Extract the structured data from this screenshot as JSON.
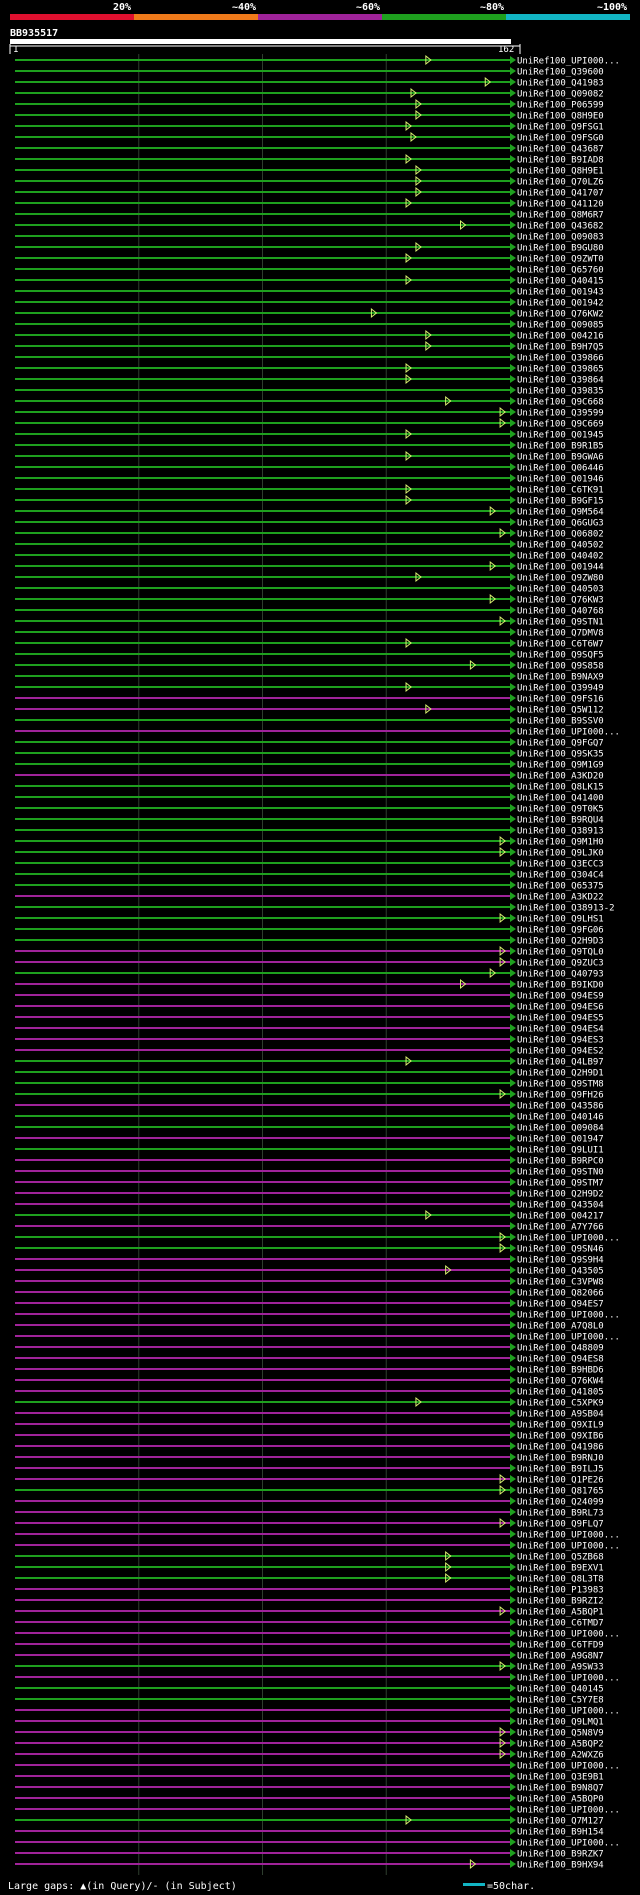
{
  "header": {
    "identity_scale": [
      {
        "label": "20%",
        "color": "#e0102f"
      },
      {
        "label": "~40%",
        "color": "#f07a1a"
      },
      {
        "label": "~60%",
        "color": "#a0239a"
      },
      {
        "label": "~80%",
        "color": "#1ea01e"
      },
      {
        "label": "~100%",
        "color": "#12b5c4"
      }
    ],
    "query_id": "BB935517",
    "ruler_start": "1",
    "ruler_end": "162"
  },
  "footer": {
    "legend_gaps": "Large gaps: ▲(in Query)/- (in Subject)",
    "legend_scale": "=50char."
  },
  "colors": {
    "green": "#1ea01e",
    "magenta": "#a0239a",
    "marker": "#d8f070",
    "background": "#000000"
  },
  "chart_data": {
    "type": "alignment",
    "query_length": 162,
    "row_count": 164,
    "rows": [
      {
        "id": "UniRef100_UPI000...",
        "color": "green",
        "end_marker": 0.83
      },
      {
        "id": "UniRef100_Q39600",
        "color": "green"
      },
      {
        "id": "UniRef100_Q41983",
        "color": "green",
        "end_marker": 0.95
      },
      {
        "id": "UniRef100_Q09082",
        "color": "green",
        "end_marker": 0.8
      },
      {
        "id": "UniRef100_P06599",
        "color": "green",
        "end_marker": 0.81
      },
      {
        "id": "UniRef100_Q8H9E0",
        "color": "green",
        "end_marker": 0.81
      },
      {
        "id": "UniRef100_Q9FSG1",
        "color": "green",
        "end_marker": 0.79
      },
      {
        "id": "UniRef100_Q9FSG0",
        "color": "green",
        "end_marker": 0.8
      },
      {
        "id": "UniRef100_Q43687",
        "color": "green"
      },
      {
        "id": "UniRef100_B9IAD8",
        "color": "green",
        "end_marker": 0.79
      },
      {
        "id": "UniRef100_Q8H9E1",
        "color": "green",
        "end_marker": 0.81
      },
      {
        "id": "UniRef100_Q70LZ6",
        "color": "green",
        "end_marker": 0.81
      },
      {
        "id": "UniRef100_Q41707",
        "color": "green",
        "end_marker": 0.81
      },
      {
        "id": "UniRef100_Q41120",
        "color": "green",
        "end_marker": 0.79
      },
      {
        "id": "UniRef100_Q8M6R7",
        "color": "green"
      },
      {
        "id": "UniRef100_Q43682",
        "color": "green",
        "end_marker": 0.9
      },
      {
        "id": "UniRef100_Q09083",
        "color": "green"
      },
      {
        "id": "UniRef100_B9GU80",
        "color": "green",
        "end_marker": 0.81
      },
      {
        "id": "UniRef100_Q9ZWT0",
        "color": "green",
        "end_marker": 0.79
      },
      {
        "id": "UniRef100_Q65760",
        "color": "green"
      },
      {
        "id": "UniRef100_Q40415",
        "color": "green",
        "end_marker": 0.79
      },
      {
        "id": "UniRef100_Q01943",
        "color": "green"
      },
      {
        "id": "UniRef100_Q01942",
        "color": "green"
      },
      {
        "id": "UniRef100_Q76KW2",
        "color": "green",
        "end_marker": 0.72
      },
      {
        "id": "UniRef100_Q09085",
        "color": "green"
      },
      {
        "id": "UniRef100_Q04216",
        "color": "green",
        "end_marker": 0.83
      },
      {
        "id": "UniRef100_B9H7Q5",
        "color": "green",
        "end_marker": 0.83
      },
      {
        "id": "UniRef100_Q39866",
        "color": "green"
      },
      {
        "id": "UniRef100_Q39865",
        "color": "green",
        "end_marker": 0.79
      },
      {
        "id": "UniRef100_Q39864",
        "color": "green",
        "end_marker": 0.79
      },
      {
        "id": "UniRef100_Q39835",
        "color": "green"
      },
      {
        "id": "UniRef100_Q9C668",
        "color": "green",
        "end_marker": 0.87
      },
      {
        "id": "UniRef100_Q39599",
        "color": "green",
        "end_marker": 0.98
      },
      {
        "id": "UniRef100_Q9C669",
        "color": "green",
        "end_marker": 0.98
      },
      {
        "id": "UniRef100_Q01945",
        "color": "green",
        "end_marker": 0.79
      },
      {
        "id": "UniRef100_B9R1B5",
        "color": "green"
      },
      {
        "id": "UniRef100_B9GWA6",
        "color": "green",
        "end_marker": 0.79
      },
      {
        "id": "UniRef100_Q06446",
        "color": "green"
      },
      {
        "id": "UniRef100_Q01946",
        "color": "green"
      },
      {
        "id": "UniRef100_C6TK91",
        "color": "green",
        "end_marker": 0.79
      },
      {
        "id": "UniRef100_B9GF15",
        "color": "green",
        "end_marker": 0.79
      },
      {
        "id": "UniRef100_Q9M564",
        "color": "green",
        "end_marker": 0.96
      },
      {
        "id": "UniRef100_Q6GUG3",
        "color": "green"
      },
      {
        "id": "UniRef100_Q06802",
        "color": "green",
        "end_marker": 0.98
      },
      {
        "id": "UniRef100_Q40502",
        "color": "green"
      },
      {
        "id": "UniRef100_Q40402",
        "color": "green"
      },
      {
        "id": "UniRef100_Q01944",
        "color": "green",
        "end_marker": 0.96
      },
      {
        "id": "UniRef100_Q9ZW80",
        "color": "green",
        "end_marker": 0.81
      },
      {
        "id": "UniRef100_Q40503",
        "color": "green"
      },
      {
        "id": "UniRef100_Q76KW3",
        "color": "green",
        "end_marker": 0.96
      },
      {
        "id": "UniRef100_Q40768",
        "color": "green"
      },
      {
        "id": "UniRef100_Q9STN1",
        "color": "green",
        "end_marker": 0.98
      },
      {
        "id": "UniRef100_Q7DMV8",
        "color": "green"
      },
      {
        "id": "UniRef100_C6T6W7",
        "color": "green",
        "end_marker": 0.79
      },
      {
        "id": "UniRef100_Q9SQF5",
        "color": "green"
      },
      {
        "id": "UniRef100_Q9S858",
        "color": "green",
        "end_marker": 0.92
      },
      {
        "id": "UniRef100_B9NAX9",
        "color": "green"
      },
      {
        "id": "UniRef100_Q39949",
        "color": "green",
        "end_marker": 0.79
      },
      {
        "id": "UniRef100_Q9FS16",
        "color": "magenta"
      },
      {
        "id": "UniRef100_Q5W112",
        "color": "magenta",
        "end_marker": 0.83
      },
      {
        "id": "UniRef100_B9SSV0",
        "color": "green"
      },
      {
        "id": "UniRef100_UPI000...",
        "color": "magenta"
      },
      {
        "id": "UniRef100_Q9FGQ7",
        "color": "green"
      },
      {
        "id": "UniRef100_Q9SK35",
        "color": "green"
      },
      {
        "id": "UniRef100_Q9M1G9",
        "color": "green"
      },
      {
        "id": "UniRef100_A3KD20",
        "color": "magenta"
      },
      {
        "id": "UniRef100_Q8LK15",
        "color": "green"
      },
      {
        "id": "UniRef100_Q41400",
        "color": "green"
      },
      {
        "id": "UniRef100_Q9T0K5",
        "color": "green"
      },
      {
        "id": "UniRef100_B9RQU4",
        "color": "green"
      },
      {
        "id": "UniRef100_Q38913",
        "color": "green"
      },
      {
        "id": "UniRef100_Q9M1H0",
        "color": "green",
        "end_marker": 0.98
      },
      {
        "id": "UniRef100_Q9LJK0",
        "color": "green",
        "end_marker": 0.98
      },
      {
        "id": "UniRef100_Q3ECC3",
        "color": "green"
      },
      {
        "id": "UniRef100_Q304C4",
        "color": "green"
      },
      {
        "id": "UniRef100_Q65375",
        "color": "green"
      },
      {
        "id": "UniRef100_A3KD22",
        "color": "magenta"
      },
      {
        "id": "UniRef100_Q38913-2",
        "color": "green"
      },
      {
        "id": "UniRef100_Q9LHS1",
        "color": "green",
        "end_marker": 0.98
      },
      {
        "id": "UniRef100_Q9FG06",
        "color": "green"
      },
      {
        "id": "UniRef100_Q2H9D3",
        "color": "green"
      },
      {
        "id": "UniRef100_Q9TQL0",
        "color": "magenta",
        "end_marker": 0.98
      },
      {
        "id": "UniRef100_Q9ZUC3",
        "color": "magenta",
        "end_marker": 0.98
      },
      {
        "id": "UniRef100_Q40793",
        "color": "green",
        "end_marker": 0.96
      },
      {
        "id": "UniRef100_B9IKD0",
        "color": "magenta",
        "end_marker": 0.9
      },
      {
        "id": "UniRef100_Q94ES9",
        "color": "magenta"
      },
      {
        "id": "UniRef100_Q94ES6",
        "color": "magenta"
      },
      {
        "id": "UniRef100_Q94ES5",
        "color": "magenta"
      },
      {
        "id": "UniRef100_Q94ES4",
        "color": "magenta"
      },
      {
        "id": "UniRef100_Q94ES3",
        "color": "magenta"
      },
      {
        "id": "UniRef100_Q94ES2",
        "color": "magenta"
      },
      {
        "id": "UniRef100_Q4LB97",
        "color": "green",
        "end_marker": 0.79
      },
      {
        "id": "UniRef100_Q2H9D1",
        "color": "green"
      },
      {
        "id": "UniRef100_Q9STM8",
        "color": "green"
      },
      {
        "id": "UniRef100_Q9FH26",
        "color": "green",
        "end_marker": 0.98
      },
      {
        "id": "UniRef100_Q43586",
        "color": "magenta"
      },
      {
        "id": "UniRef100_Q40146",
        "color": "green"
      },
      {
        "id": "UniRef100_Q09084",
        "color": "green"
      },
      {
        "id": "UniRef100_Q01947",
        "color": "magenta"
      },
      {
        "id": "UniRef100_Q9LUI1",
        "color": "green"
      },
      {
        "id": "UniRef100_B9RPC0",
        "color": "magenta"
      },
      {
        "id": "UniRef100_Q9STN0",
        "color": "magenta"
      },
      {
        "id": "UniRef100_Q9STM7",
        "color": "magenta"
      },
      {
        "id": "UniRef100_Q2H9D2",
        "color": "magenta"
      },
      {
        "id": "UniRef100_Q43504",
        "color": "magenta"
      },
      {
        "id": "UniRef100_Q04217",
        "color": "green",
        "end_marker": 0.83
      },
      {
        "id": "UniRef100_A7Y766",
        "color": "magenta"
      },
      {
        "id": "UniRef100_UPI000...",
        "color": "green",
        "end_marker": 0.98
      },
      {
        "id": "UniRef100_Q9SN46",
        "color": "green",
        "end_marker": 0.98
      },
      {
        "id": "UniRef100_Q9S9H4",
        "color": "magenta"
      },
      {
        "id": "UniRef100_Q43505",
        "color": "magenta",
        "end_marker": 0.87
      },
      {
        "id": "UniRef100_C3VPW8",
        "color": "magenta"
      },
      {
        "id": "UniRef100_Q82066",
        "color": "magenta"
      },
      {
        "id": "UniRef100_Q94ES7",
        "color": "magenta"
      },
      {
        "id": "UniRef100_UPI000...",
        "color": "magenta"
      },
      {
        "id": "UniRef100_A7Q8L0",
        "color": "magenta"
      },
      {
        "id": "UniRef100_UPI000...",
        "color": "magenta"
      },
      {
        "id": "UniRef100_Q48809",
        "color": "magenta"
      },
      {
        "id": "UniRef100_Q94ES8",
        "color": "magenta"
      },
      {
        "id": "UniRef100_B9HBD6",
        "color": "magenta"
      },
      {
        "id": "UniRef100_Q76KW4",
        "color": "magenta"
      },
      {
        "id": "UniRef100_Q41805",
        "color": "magenta"
      },
      {
        "id": "UniRef100_C5XPK9",
        "color": "green",
        "end_marker": 0.81
      },
      {
        "id": "UniRef100_A9SB04",
        "color": "magenta"
      },
      {
        "id": "UniRef100_Q9XIL9",
        "color": "magenta"
      },
      {
        "id": "UniRef100_Q9XIB6",
        "color": "magenta"
      },
      {
        "id": "UniRef100_Q41986",
        "color": "magenta"
      },
      {
        "id": "UniRef100_B9RNJ0",
        "color": "magenta"
      },
      {
        "id": "UniRef100_B9ILJ5",
        "color": "magenta"
      },
      {
        "id": "UniRef100_Q1PE26",
        "color": "magenta",
        "end_marker": 0.98
      },
      {
        "id": "UniRef100_Q81765",
        "color": "green",
        "end_marker": 0.98
      },
      {
        "id": "UniRef100_Q24099",
        "color": "magenta"
      },
      {
        "id": "UniRef100_B9RL73",
        "color": "magenta"
      },
      {
        "id": "UniRef100_Q9FLQ7",
        "color": "magenta",
        "end_marker": 0.98
      },
      {
        "id": "UniRef100_UPI000...",
        "color": "magenta"
      },
      {
        "id": "UniRef100_UPI000...",
        "color": "magenta"
      },
      {
        "id": "UniRef100_Q5ZB68",
        "color": "green",
        "end_marker": 0.87
      },
      {
        "id": "UniRef100_B9EXV1",
        "color": "green",
        "end_marker": 0.87
      },
      {
        "id": "UniRef100_Q8L3T8",
        "color": "green",
        "end_marker": 0.87
      },
      {
        "id": "UniRef100_P13983",
        "color": "magenta"
      },
      {
        "id": "UniRef100_B9RZI2",
        "color": "magenta"
      },
      {
        "id": "UniRef100_A5BQP1",
        "color": "magenta",
        "end_marker": 0.98
      },
      {
        "id": "UniRef100_C6TMD7",
        "color": "magenta"
      },
      {
        "id": "UniRef100_UPI000...",
        "color": "magenta"
      },
      {
        "id": "UniRef100_C6TFD9",
        "color": "magenta"
      },
      {
        "id": "UniRef100_A9G8N7",
        "color": "magenta"
      },
      {
        "id": "UniRef100_A9SW33",
        "color": "green",
        "end_marker": 0.98
      },
      {
        "id": "UniRef100_UPI000...",
        "color": "magenta"
      },
      {
        "id": "UniRef100_Q40145",
        "color": "green"
      },
      {
        "id": "UniRef100_C5Y7E8",
        "color": "green"
      },
      {
        "id": "UniRef100_UPI000...",
        "color": "magenta"
      },
      {
        "id": "UniRef100_Q9LMQ1",
        "color": "magenta"
      },
      {
        "id": "UniRef100_Q5N8V9",
        "color": "magenta",
        "end_marker": 0.98
      },
      {
        "id": "UniRef100_A5BQP2",
        "color": "magenta",
        "end_marker": 0.98
      },
      {
        "id": "UniRef100_A2WXZ6",
        "color": "magenta",
        "end_marker": 0.98
      },
      {
        "id": "UniRef100_UPI000...",
        "color": "magenta"
      },
      {
        "id": "UniRef100_Q3E9B1",
        "color": "magenta"
      },
      {
        "id": "UniRef100_B9N8Q7",
        "color": "magenta"
      },
      {
        "id": "UniRef100_A5BQP0",
        "color": "magenta"
      },
      {
        "id": "UniRef100_UPI000...",
        "color": "magenta"
      },
      {
        "id": "UniRef100_Q7M127",
        "color": "green",
        "end_marker": 0.79
      },
      {
        "id": "UniRef100_B9H154",
        "color": "magenta"
      },
      {
        "id": "UniRef100_UPI000...",
        "color": "magenta"
      },
      {
        "id": "UniRef100_B9RZK7",
        "color": "magenta"
      },
      {
        "id": "UniRef100_B9HX94",
        "color": "magenta",
        "end_marker": 0.92
      }
    ]
  }
}
